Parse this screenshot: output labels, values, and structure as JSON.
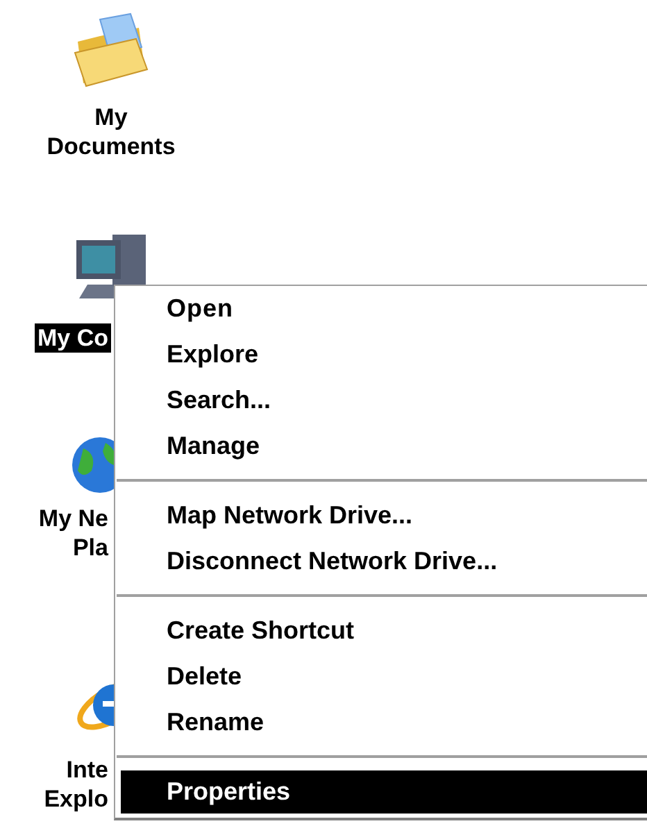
{
  "desktop_icons": [
    {
      "kind": "folder",
      "label_lines": [
        "My",
        "Documents"
      ],
      "selected": false
    },
    {
      "kind": "computer",
      "label_lines": [
        "My Co"
      ],
      "selected": true
    },
    {
      "kind": "network",
      "label_lines": [
        "My Ne",
        "Pla"
      ],
      "selected": false
    },
    {
      "kind": "browser",
      "label_lines": [
        "Inte",
        "Explo"
      ],
      "selected": false
    }
  ],
  "context_menu": {
    "items": [
      {
        "kind": "item",
        "label": "Open",
        "bold": true,
        "selected": false
      },
      {
        "kind": "item",
        "label": "Explore",
        "bold": false,
        "selected": false
      },
      {
        "kind": "item",
        "label": "Search...",
        "bold": false,
        "selected": false
      },
      {
        "kind": "item",
        "label": "Manage",
        "bold": false,
        "selected": false
      },
      {
        "kind": "separator"
      },
      {
        "kind": "item",
        "label": "Map Network Drive...",
        "bold": false,
        "selected": false
      },
      {
        "kind": "item",
        "label": "Disconnect Network Drive...",
        "bold": false,
        "selected": false
      },
      {
        "kind": "separator"
      },
      {
        "kind": "item",
        "label": "Create Shortcut",
        "bold": false,
        "selected": false
      },
      {
        "kind": "item",
        "label": "Delete",
        "bold": false,
        "selected": false
      },
      {
        "kind": "item",
        "label": "Rename",
        "bold": false,
        "selected": false
      },
      {
        "kind": "separator"
      },
      {
        "kind": "item",
        "label": "Properties",
        "bold": false,
        "selected": true
      }
    ]
  }
}
